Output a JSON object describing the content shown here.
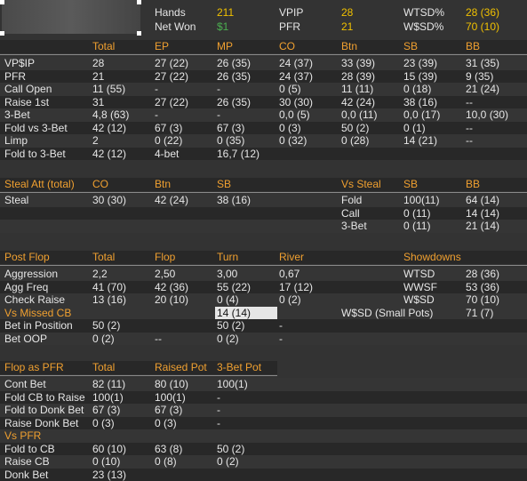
{
  "top": {
    "hands_label": "Hands",
    "hands_value": "211",
    "netwon_label": "Net Won",
    "netwon_value": "$1",
    "vpip_label": "VPIP",
    "vpip_value": "28",
    "pfr_label": "PFR",
    "pfr_value": "21",
    "wtsd_label": "WTSD%",
    "wtsd_value": "28 (36)",
    "wsd_label": "W$SD%",
    "wsd_value": "70 (10)"
  },
  "pos": {
    "headers": [
      "Total",
      "EP",
      "MP",
      "CO",
      "Btn",
      "SB",
      "BB"
    ],
    "rows": [
      {
        "label": "VP$IP",
        "cells": [
          "28",
          "27 (22)",
          "26 (35)",
          "24 (37)",
          "33 (39)",
          "23 (39)",
          "31 (35)"
        ]
      },
      {
        "label": "PFR",
        "cells": [
          "21",
          "27 (22)",
          "26 (35)",
          "24 (37)",
          "28 (39)",
          "15 (39)",
          "9 (35)"
        ]
      },
      {
        "label": "Call Open",
        "cells": [
          "11 (55)",
          "-",
          "-",
          "0 (5)",
          "11 (11)",
          "0 (18)",
          "21 (24)"
        ]
      },
      {
        "label": "Raise 1st",
        "cells": [
          "31",
          "27 (22)",
          "26 (35)",
          "30 (30)",
          "42 (24)",
          "38 (16)",
          "--"
        ]
      },
      {
        "label": "3-Bet",
        "cells": [
          "4,8 (63)",
          "-",
          "-",
          "0,0 (5)",
          "0,0 (11)",
          "0,0 (17)",
          "10,0 (30)"
        ]
      },
      {
        "label": "Fold vs 3-Bet",
        "cells": [
          "42 (12)",
          "67 (3)",
          "67 (3)",
          "0 (3)",
          "50 (2)",
          "0 (1)",
          "--"
        ]
      },
      {
        "label": "Limp",
        "cells": [
          "2",
          "0 (22)",
          "0 (35)",
          "0 (32)",
          "0 (28)",
          "14 (21)",
          "--"
        ]
      },
      {
        "label": "Fold to 3-Bet",
        "cells": [
          "42 (12)",
          "4-bet",
          "16,7 (12)",
          "",
          "",
          "",
          ""
        ]
      }
    ]
  },
  "steal": {
    "title": "Steal Att (total)",
    "h_co": "CO",
    "h_btn": "Btn",
    "h_sb": "SB",
    "vs_title": "Vs Steal",
    "vs_sb": "SB",
    "vs_bb": "BB",
    "steal_label": "Steal",
    "steal_co": "30 (30)",
    "steal_btn": "42 (24)",
    "steal_sb": "38 (16)",
    "vs_rows": [
      {
        "label": "Fold",
        "sb": "100(11)",
        "bb": "64 (14)"
      },
      {
        "label": "Call",
        "sb": "0 (11)",
        "bb": "14 (14)"
      },
      {
        "label": "3-Bet",
        "sb": "0 (11)",
        "bb": "21 (14)"
      }
    ]
  },
  "postflop": {
    "title": "Post Flop",
    "h_total": "Total",
    "h_flop": "Flop",
    "h_turn": "Turn",
    "h_river": "River",
    "showdowns_title": "Showdowns",
    "rows": [
      {
        "label": "Aggression",
        "total": "2,2",
        "flop": "2,50",
        "turn": "3,00",
        "river": "0,67",
        "sd_label": "WTSD",
        "sd_value": "28 (36)"
      },
      {
        "label": "Agg Freq",
        "total": "41 (70)",
        "flop": "42 (36)",
        "turn": "55 (22)",
        "river": "17 (12)",
        "sd_label": "WWSF",
        "sd_value": "53 (36)"
      },
      {
        "label": "Check Raise",
        "total": "13 (16)",
        "flop": "20 (10)",
        "turn": "0 (4)",
        "river": "0 (2)",
        "sd_label": "W$SD",
        "sd_value": "70 (10)"
      }
    ],
    "missed_title": "Vs Missed CB",
    "missed_turn": "14 (14)",
    "small_pots_label": "W$SD (Small Pots)",
    "small_pots_value": "71 (7)",
    "bip_label": "Bet in Position",
    "bip_total": "50 (2)",
    "bip_turn": "50 (2)",
    "bip_river": "-",
    "boop_label": "Bet OOP",
    "boop_total": "0 (2)",
    "boop_flop": "--",
    "boop_turn": "0 (2)",
    "boop_river": "-"
  },
  "pfr": {
    "title": "Flop as PFR",
    "h_total": "Total",
    "h_raised": "Raised Pot",
    "h_3bet": "3-Bet Pot",
    "rows": [
      {
        "label": "Cont Bet",
        "total": "82 (11)",
        "raised": "80 (10)",
        "threebet": "100(1)"
      },
      {
        "label": "Fold CB to Raise",
        "total": "100(1)",
        "raised": "100(1)",
        "threebet": "-"
      },
      {
        "label": "Fold to Donk Bet",
        "total": "67 (3)",
        "raised": "67 (3)",
        "threebet": "-"
      },
      {
        "label": "Raise Donk Bet",
        "total": "0 (3)",
        "raised": "0 (3)",
        "threebet": "-"
      }
    ],
    "vs_title": "Vs PFR",
    "vs_rows": [
      {
        "label": "Fold to CB",
        "total": "60 (10)",
        "raised": "63 (8)",
        "threebet": "50 (2)"
      },
      {
        "label": "Raise CB",
        "total": "0 (10)",
        "raised": "0 (8)",
        "threebet": "0 (2)"
      },
      {
        "label": "Donk Bet",
        "total": "23 (13)",
        "raised": "",
        "threebet": ""
      }
    ]
  }
}
